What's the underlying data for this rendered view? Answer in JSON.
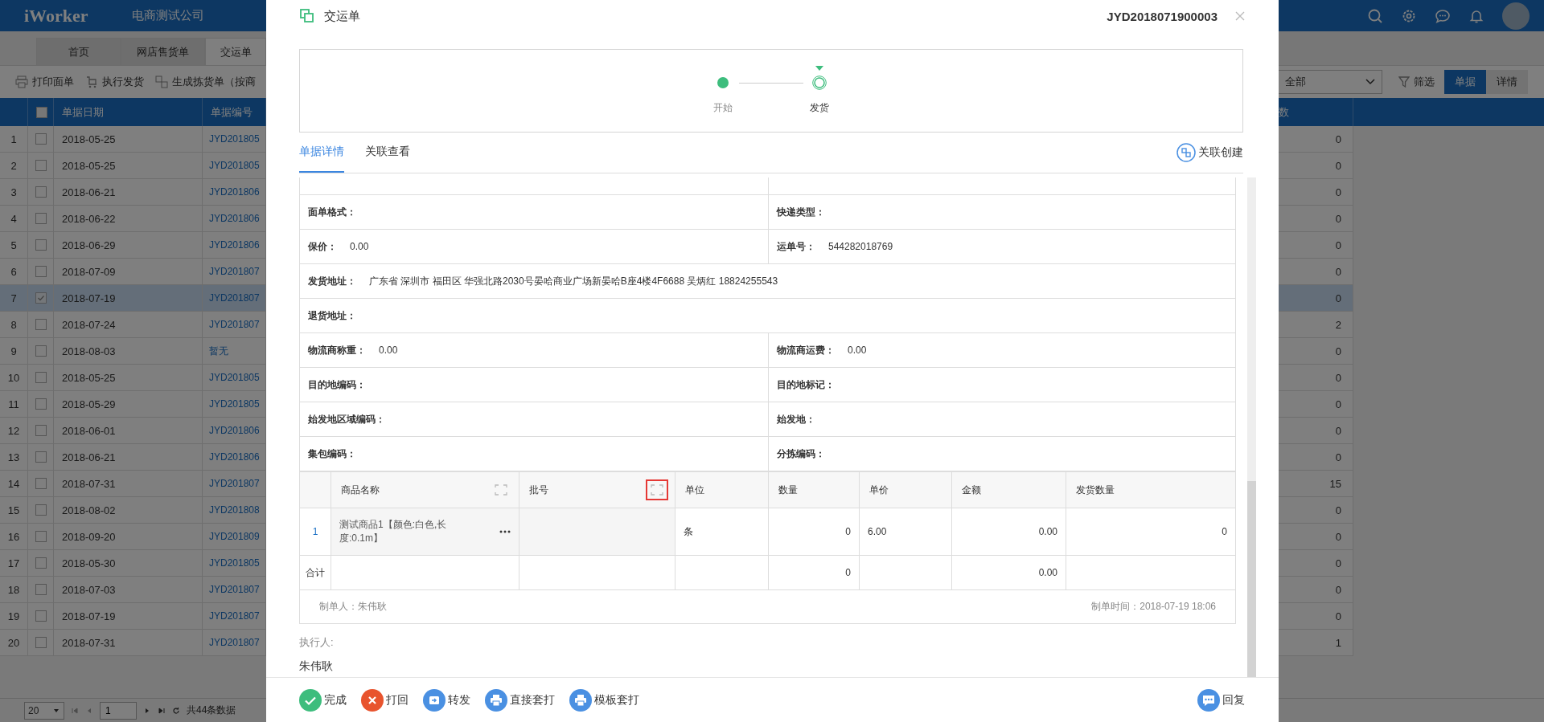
{
  "app": {
    "logo": "iWorker",
    "company": "电商测试公司"
  },
  "tabs": [
    {
      "label": "首页",
      "selected": false
    },
    {
      "label": "网店售货单",
      "selected": false
    },
    {
      "label": "交运单",
      "selected": true
    }
  ],
  "toolbar": {
    "actions": [
      "打印面单",
      "执行发货",
      "生成拣货单（按商"
    ],
    "status_select": {
      "value": "全部"
    },
    "filter": "筛选",
    "views": [
      {
        "label": "单据",
        "selected": true
      },
      {
        "label": "详情",
        "selected": false
      }
    ]
  },
  "table": {
    "all_checked": false,
    "columns": [
      "单据日期",
      "单据编号",
      "数"
    ],
    "rows": [
      {
        "index": "1",
        "checked": false,
        "selected": false,
        "date": "2018-05-25",
        "number": "JYD201805",
        "count": "0"
      },
      {
        "index": "2",
        "checked": false,
        "selected": false,
        "date": "2018-05-25",
        "number": "JYD201805",
        "count": "0"
      },
      {
        "index": "3",
        "checked": false,
        "selected": false,
        "date": "2018-06-21",
        "number": "JYD201806",
        "count": "0"
      },
      {
        "index": "4",
        "checked": false,
        "selected": false,
        "date": "2018-06-22",
        "number": "JYD201806",
        "count": "0"
      },
      {
        "index": "5",
        "checked": false,
        "selected": false,
        "date": "2018-06-29",
        "number": "JYD201806",
        "count": "0"
      },
      {
        "index": "6",
        "checked": false,
        "selected": false,
        "date": "2018-07-09",
        "number": "JYD201807",
        "count": "0"
      },
      {
        "index": "7",
        "checked": true,
        "selected": true,
        "date": "2018-07-19",
        "number": "JYD201807",
        "count": "0"
      },
      {
        "index": "8",
        "checked": false,
        "selected": false,
        "date": "2018-07-24",
        "number": "JYD201807",
        "count": "2"
      },
      {
        "index": "9",
        "checked": false,
        "selected": false,
        "date": "2018-08-03",
        "number": "暂无",
        "count": "0"
      },
      {
        "index": "10",
        "checked": false,
        "selected": false,
        "date": "2018-05-25",
        "number": "JYD201805",
        "count": "0"
      },
      {
        "index": "11",
        "checked": false,
        "selected": false,
        "date": "2018-05-29",
        "number": "JYD201805",
        "count": "0"
      },
      {
        "index": "12",
        "checked": false,
        "selected": false,
        "date": "2018-06-01",
        "number": "JYD201806",
        "count": "0"
      },
      {
        "index": "13",
        "checked": false,
        "selected": false,
        "date": "2018-06-21",
        "number": "JYD201806",
        "count": "0"
      },
      {
        "index": "14",
        "checked": false,
        "selected": false,
        "date": "2018-07-31",
        "number": "JYD201807",
        "count": "15"
      },
      {
        "index": "15",
        "checked": false,
        "selected": false,
        "date": "2018-08-02",
        "number": "JYD201808",
        "count": "0"
      },
      {
        "index": "16",
        "checked": false,
        "selected": false,
        "date": "2018-09-20",
        "number": "JYD201809",
        "count": "0"
      },
      {
        "index": "17",
        "checked": false,
        "selected": false,
        "date": "2018-05-30",
        "number": "JYD201805",
        "count": "0"
      },
      {
        "index": "18",
        "checked": false,
        "selected": false,
        "date": "2018-07-03",
        "number": "JYD201807",
        "count": "0"
      },
      {
        "index": "19",
        "checked": false,
        "selected": false,
        "date": "2018-07-19",
        "number": "JYD201807",
        "count": "0"
      },
      {
        "index": "20",
        "checked": false,
        "selected": false,
        "date": "2018-07-31",
        "number": "JYD201807",
        "count": "1"
      }
    ]
  },
  "pager": {
    "page_size": "20",
    "page": "1",
    "total": "共44条数据"
  },
  "dialog": {
    "title": "交运单",
    "number": "JYD2018071900003",
    "flow": {
      "steps": [
        {
          "label": "开始",
          "completed": true,
          "current": false
        },
        {
          "label": "发货",
          "completed": false,
          "current": true
        }
      ]
    },
    "tabs": [
      {
        "label": "单据详情",
        "selected": true
      },
      {
        "label": "关联查看",
        "selected": false
      }
    ],
    "link_create": "关联创建",
    "fields": [
      {
        "cells": [
          {
            "label": "面单格式："
          },
          {
            "label": "快递类型："
          }
        ]
      },
      {
        "cells": [
          {
            "label": "保价：",
            "value": "0.00"
          },
          {
            "label": "运单号：",
            "value": "544282018769"
          }
        ]
      },
      {
        "cells": [
          {
            "label": "发货地址：",
            "value": "广东省 深圳市 福田区 华强北路2030号晏哈商业广场新晏哈B座4楼4F6688 吴炳红 18824255543"
          }
        ]
      },
      {
        "cells": [
          {
            "label": "退货地址："
          }
        ]
      },
      {
        "cells": [
          {
            "label": "物流商称重：",
            "value": "0.00"
          },
          {
            "label": "物流商运费：",
            "value": "0.00"
          }
        ]
      },
      {
        "cells": [
          {
            "label": "目的地编码："
          },
          {
            "label": "目的地标记："
          }
        ]
      },
      {
        "cells": [
          {
            "label": "始发地区域编码："
          },
          {
            "label": "始发地："
          }
        ]
      },
      {
        "cells": [
          {
            "label": "集包编码："
          },
          {
            "label": "分拣编码："
          }
        ]
      }
    ],
    "items": {
      "columns": [
        {
          "label": "商品名称",
          "expandable": true,
          "highlighted": false
        },
        {
          "label": "批号",
          "expandable": true,
          "highlighted": true
        },
        {
          "label": "单位",
          "expandable": false
        },
        {
          "label": "数量",
          "expandable": false
        },
        {
          "label": "单价",
          "expandable": false
        },
        {
          "label": "金额",
          "expandable": false
        },
        {
          "label": "发货数量",
          "expandable": false
        }
      ],
      "rows": [
        {
          "index": "1",
          "name": "测试商品1【颜色:白色,长度:0.1m】",
          "unit": "条",
          "qty": "0",
          "price": "6.00",
          "amount": "0.00",
          "ship_qty": "0"
        }
      ],
      "total": {
        "label": "合计",
        "qty": "0",
        "amount": "0.00"
      },
      "creator": "制单人：朱伟耿",
      "created_time": "制单时间：2018-07-19 18:06"
    },
    "executor": {
      "label": "执行人:",
      "name": "朱伟耿"
    },
    "actions": [
      {
        "label": "完成",
        "kind": "done"
      },
      {
        "label": "打回",
        "kind": "reject"
      },
      {
        "label": "转发",
        "kind": "forward"
      },
      {
        "label": "直接套打",
        "kind": "print"
      },
      {
        "label": "模板套打",
        "kind": "print"
      }
    ],
    "reply": "回复"
  }
}
